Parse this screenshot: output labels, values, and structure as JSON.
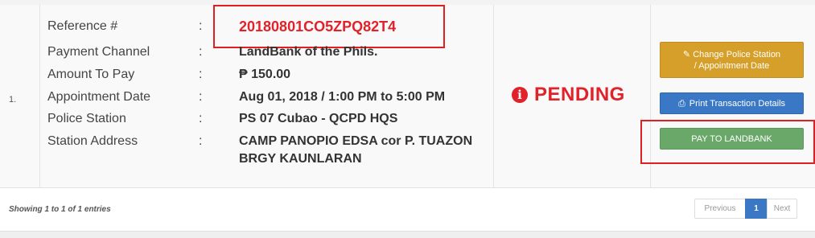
{
  "row": {
    "number": "1.",
    "details": [
      {
        "label": "Reference #",
        "value": "20180801CO5ZPQ82T4"
      },
      {
        "label": "Payment Channel",
        "value": "LandBank of the Phils."
      },
      {
        "label": "Amount To Pay",
        "value": "₱ 150.00"
      },
      {
        "label": "Appointment Date",
        "value": "Aug 01, 2018 / 1:00 PM to 5:00 PM"
      },
      {
        "label": "Police Station",
        "value": "PS 07 Cubao - QCPD HQS"
      },
      {
        "label": "Station Address",
        "value_line1": "CAMP PANOPIO EDSA cor P. TUAZON",
        "value_line2": "BRGY KAUNLARAN"
      }
    ],
    "colon": ":",
    "status": {
      "icon": "exclamation-circle-icon",
      "text": "PENDING",
      "color": "#e0222b"
    },
    "actions": {
      "change_line1": "Change Police Station",
      "change_line2": "/ Appointment Date",
      "print": "Print Transaction Details",
      "pay": "PAY TO LANDBANK"
    }
  },
  "footer": {
    "info": "Showing 1 to 1 of 1 entries",
    "pagination": {
      "previous": "Previous",
      "current": "1",
      "next": "Next"
    }
  },
  "colors": {
    "accent_red": "#e0222b",
    "change_btn": "#d69f2a",
    "print_btn": "#3a78c5",
    "pay_btn": "#6aa86a"
  }
}
